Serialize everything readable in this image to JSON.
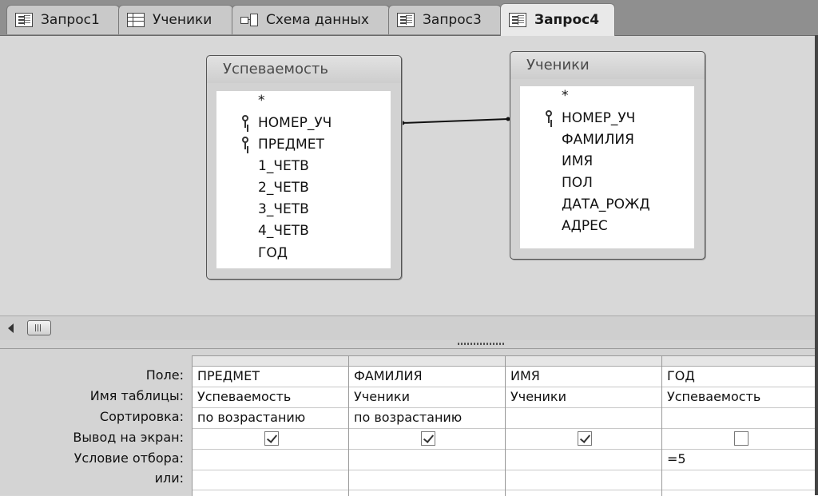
{
  "tabs": [
    {
      "label": "Запрос1",
      "icon": "query-icon"
    },
    {
      "label": "Ученики",
      "icon": "table-icon"
    },
    {
      "label": "Схема данных",
      "icon": "relationships-icon"
    },
    {
      "label": "Запрос3",
      "icon": "query-icon"
    },
    {
      "label": "Запрос4",
      "icon": "query-icon",
      "active": true
    }
  ],
  "tables": [
    {
      "title": "Успеваемость",
      "fields": [
        {
          "name": "*",
          "key": false
        },
        {
          "name": "НОМЕР_УЧ",
          "key": true
        },
        {
          "name": "ПРЕДМЕТ",
          "key": true
        },
        {
          "name": "1_ЧЕТВ",
          "key": false
        },
        {
          "name": "2_ЧЕТВ",
          "key": false
        },
        {
          "name": "3_ЧЕТВ",
          "key": false
        },
        {
          "name": "4_ЧЕТВ",
          "key": false
        },
        {
          "name": "ГОД",
          "key": false
        }
      ]
    },
    {
      "title": "Ученики",
      "fields": [
        {
          "name": "*",
          "key": false
        },
        {
          "name": "НОМЕР_УЧ",
          "key": true
        },
        {
          "name": "ФАМИЛИЯ",
          "key": false
        },
        {
          "name": "ИМЯ",
          "key": false
        },
        {
          "name": "ПОЛ",
          "key": false
        },
        {
          "name": "ДАТА_РОЖД",
          "key": false
        },
        {
          "name": "АДРЕС",
          "key": false
        }
      ]
    }
  ],
  "grid": {
    "row_labels": [
      "Поле:",
      "Имя таблицы:",
      "Сортировка:",
      "Вывод на экран:",
      "Условие отбора:",
      "или:"
    ],
    "columns": [
      {
        "field": "ПРЕДМЕТ",
        "table": "Успеваемость",
        "sort": "по возрастанию",
        "show": true,
        "criteria": "",
        "or": ""
      },
      {
        "field": "ФАМИЛИЯ",
        "table": "Ученики",
        "sort": "по возрастанию",
        "show": true,
        "criteria": "",
        "or": ""
      },
      {
        "field": "ИМЯ",
        "table": "Ученики",
        "sort": "",
        "show": true,
        "criteria": "",
        "or": ""
      },
      {
        "field": "ГОД",
        "table": "Успеваемость",
        "sort": "",
        "show": false,
        "criteria": "=5",
        "or": ""
      }
    ]
  }
}
